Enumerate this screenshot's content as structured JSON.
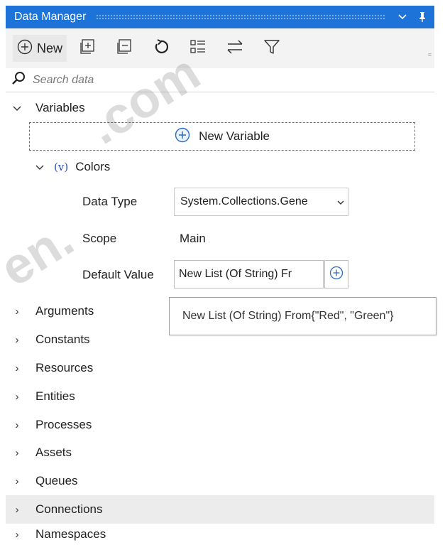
{
  "window": {
    "title": "Data Manager"
  },
  "toolbar": {
    "new_label": "New"
  },
  "search": {
    "placeholder": "Search data"
  },
  "variables": {
    "label": "Variables",
    "new_variable_label": "New Variable",
    "items": [
      {
        "badge": "(v)",
        "name": "Colors",
        "data_type_label": "Data Type",
        "data_type_value": "System.Collections.Gene",
        "scope_label": "Scope",
        "scope_value": "Main",
        "default_value_label": "Default Value",
        "default_value": "New List (Of String) Fr",
        "default_value_tooltip": "New List (Of String) From{\"Red\", \"Green\"}"
      }
    ]
  },
  "sections": [
    {
      "label": "Arguments"
    },
    {
      "label": "Constants"
    },
    {
      "label": "Resources"
    },
    {
      "label": "Entities"
    },
    {
      "label": "Processes"
    },
    {
      "label": "Assets"
    },
    {
      "label": "Queues"
    },
    {
      "label": "Connections"
    },
    {
      "label": "Namespaces"
    }
  ],
  "watermark": {
    "part1": ".com",
    "part2": "en."
  },
  "colors": {
    "title_bar": "#1e73d8",
    "toolbar_bg": "#f3f3f3",
    "hover_row": "#ececec",
    "accent_icon": "#2c6bc9"
  },
  "icons": {
    "collapse": "chevron-down-icon",
    "pin": "pin-icon",
    "new": "add-circle-icon",
    "expand_all": "expand-all-icon",
    "collapse_all": "collapse-all-icon",
    "refresh": "refresh-icon",
    "list_view": "list-view-icon",
    "sort": "swap-icon",
    "filter": "filter-icon",
    "search": "search-icon"
  }
}
